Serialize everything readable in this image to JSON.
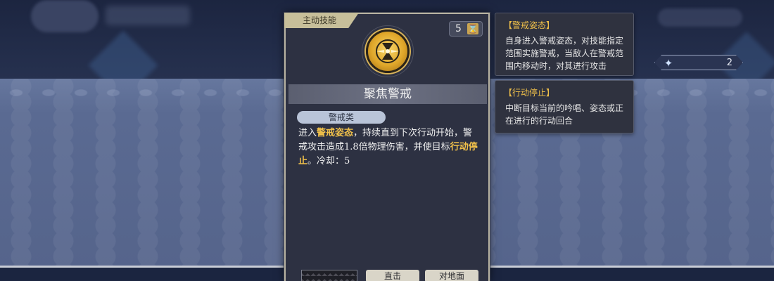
{
  "card": {
    "tag": "主动技能",
    "cost": "5",
    "skill_name": "聚焦警戒",
    "type": "警戒类",
    "description": [
      {
        "text": "进入",
        "hl": false
      },
      {
        "text": "警戒姿态",
        "hl": true
      },
      {
        "text": "，持续直到下次行动开始，警戒攻击造成1.8倍物理伤害，并使目标",
        "hl": false
      },
      {
        "text": "行动停止",
        "hl": true
      },
      {
        "text": "。冷却：5",
        "hl": false
      }
    ],
    "bottom_tags": [
      "直击",
      "对地面"
    ]
  },
  "tooltips": [
    {
      "title": "【警戒姿态】",
      "body": [
        "自身进入警戒姿态，对技能指定",
        "范围实施警戒，当敌人在警戒范",
        "围内移动时，对其进行攻击"
      ]
    },
    {
      "title": "【行动停止】",
      "body": [
        "中断目标当前的吟唱、姿态或正",
        "在进行的行动回合"
      ]
    }
  ],
  "resource": {
    "count": "2",
    "icon": "crystal-icon"
  },
  "colors": {
    "highlight": "#f0c04a",
    "card_bg": "#2d3142",
    "band_bg": "#5a6a92"
  }
}
